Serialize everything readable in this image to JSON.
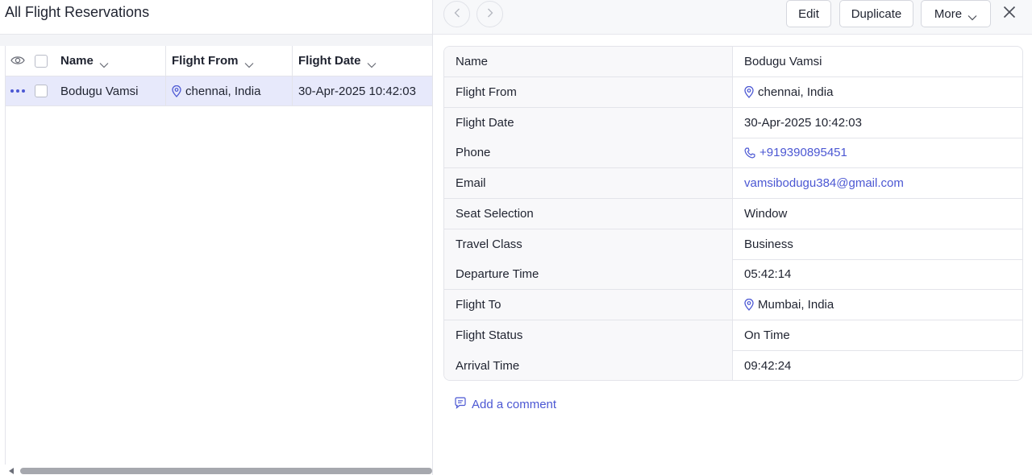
{
  "list": {
    "title": "All Flight Reservations",
    "columns": [
      "Name",
      "Flight From",
      "Flight Date"
    ],
    "rows": [
      {
        "name": "Bodugu Vamsi",
        "flight_from": "chennai, India",
        "flight_date": "30-Apr-2025 10:42:03"
      }
    ]
  },
  "toolbar": {
    "edit": "Edit",
    "duplicate": "Duplicate",
    "more": "More"
  },
  "details": [
    {
      "label": "Name",
      "value": "Bodugu Vamsi"
    },
    {
      "label": "Flight From",
      "value": "chennai, India"
    },
    {
      "label": "Flight Date",
      "value": "30-Apr-2025 10:42:03"
    },
    {
      "label": "Phone",
      "value": "+919390895451"
    },
    {
      "label": "Email",
      "value": "vamsibodugu384@gmail.com"
    },
    {
      "label": "Seat Selection",
      "value": "Window"
    },
    {
      "label": "Travel Class",
      "value": "Business"
    },
    {
      "label": "Departure Time",
      "value": "05:42:14"
    },
    {
      "label": "Flight To",
      "value": "Mumbai, India"
    },
    {
      "label": "Flight Status",
      "value": "On Time"
    },
    {
      "label": "Arrival Time",
      "value": "09:42:24"
    }
  ],
  "comment": {
    "label": "Add a comment"
  },
  "colors": {
    "accent": "#4b57d3",
    "selected_row": "#e7e9fb",
    "label_bg": "#f8f8fa",
    "border": "#e3e4ea"
  }
}
